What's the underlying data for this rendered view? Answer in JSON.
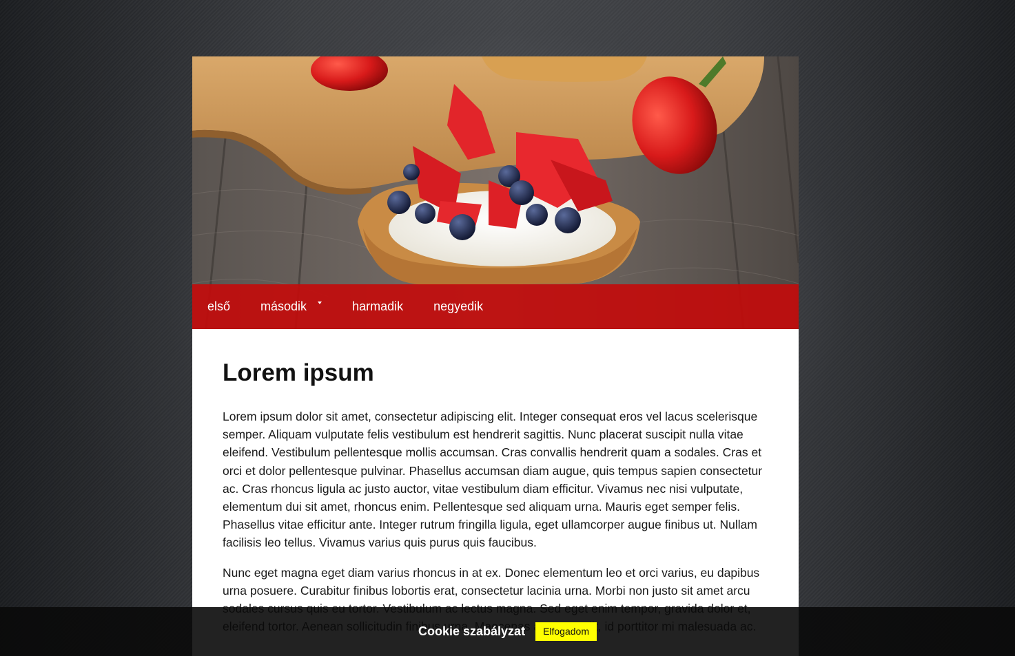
{
  "nav": {
    "items": [
      {
        "label": "első",
        "has_dropdown": false
      },
      {
        "label": "második",
        "has_dropdown": true
      },
      {
        "label": "harmadik",
        "has_dropdown": false
      },
      {
        "label": "negyedik",
        "has_dropdown": false
      }
    ]
  },
  "hero": {
    "image": "fruit-tart-photo"
  },
  "content": {
    "title": "Lorem ipsum",
    "paragraphs": [
      "Lorem ipsum dolor sit amet, consectetur adipiscing elit. Integer consequat eros vel lacus scelerisque semper. Aliquam vulputate felis vestibulum est hendrerit sagittis. Nunc placerat suscipit nulla vitae eleifend. Vestibulum pellentesque mollis accumsan. Cras convallis hendrerit quam a sodales. Cras et orci et dolor pellentesque pulvinar. Phasellus accumsan diam augue, quis tempus sapien consectetur ac. Cras rhoncus ligula ac justo auctor, vitae vestibulum diam efficitur. Vivamus nec nisi vulputate, elementum dui sit amet, rhoncus enim. Pellentesque sed aliquam urna. Mauris eget semper felis. Phasellus vitae efficitur ante. Integer rutrum fringilla ligula, eget ullamcorper augue finibus ut. Nullam facilisis leo tellus. Vivamus varius quis purus quis faucibus.",
      "Nunc eget magna eget diam varius rhoncus in at ex. Donec elementum leo et orci varius, eu dapibus urna posuere. Curabitur finibus lobortis erat, consectetur lacinia urna. Morbi non justo sit amet arcu sodales cursus quis eu tortor. Vestibulum ac lectus magna. Sed eget enim tempor, gravida dolor et, eleifend tortor. Aenean sollicitudin finibus urna. Maecenas at nunc velit, id porttitor mi malesuada ac."
    ]
  },
  "cookie": {
    "text": "Cookie szabályzat",
    "button_label": "Elfogadom"
  },
  "colors": {
    "nav_bg": "#c40a0a",
    "cookie_button": "#ffff00",
    "cookie_bar": "#0a0a0a"
  }
}
